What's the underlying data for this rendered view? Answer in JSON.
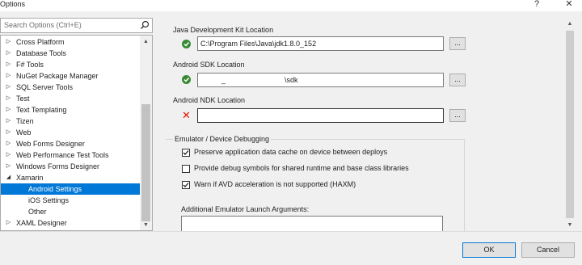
{
  "window": {
    "title": "Options",
    "help_glyph": "?",
    "close_glyph": "✕"
  },
  "search": {
    "placeholder": "Search Options (Ctrl+E)"
  },
  "tree": {
    "items": [
      {
        "label": "Cross Platform",
        "expander": "▷",
        "selected": false
      },
      {
        "label": "Database Tools",
        "expander": "▷",
        "selected": false
      },
      {
        "label": "F# Tools",
        "expander": "▷",
        "selected": false
      },
      {
        "label": "NuGet Package Manager",
        "expander": "▷",
        "selected": false
      },
      {
        "label": "SQL Server Tools",
        "expander": "▷",
        "selected": false
      },
      {
        "label": "Test",
        "expander": "▷",
        "selected": false
      },
      {
        "label": "Text Templating",
        "expander": "▷",
        "selected": false
      },
      {
        "label": "Tizen",
        "expander": "▷",
        "selected": false
      },
      {
        "label": "Web",
        "expander": "▷",
        "selected": false
      },
      {
        "label": "Web Forms Designer",
        "expander": "▷",
        "selected": false
      },
      {
        "label": "Web Performance Test Tools",
        "expander": "▷",
        "selected": false
      },
      {
        "label": "Windows Forms Designer",
        "expander": "▷",
        "selected": false
      },
      {
        "label": "Xamarin",
        "expander": "◢",
        "selected": false
      },
      {
        "label": "Android Settings",
        "expander": "",
        "selected": true
      },
      {
        "label": "iOS Settings",
        "expander": "",
        "selected": false
      },
      {
        "label": "Other",
        "expander": "",
        "selected": false
      },
      {
        "label": "XAML Designer",
        "expander": "▷",
        "selected": false
      }
    ]
  },
  "settings": {
    "jdk": {
      "label": "Java Development Kit Location",
      "value": "C:\\Program Files\\Java\\jdk1.8.0_152",
      "status": "ok",
      "browse": "..."
    },
    "sdk": {
      "label": "Android SDK Location",
      "value_part1": "_",
      "value_part2": "\\sdk",
      "status": "ok",
      "browse": "..."
    },
    "ndk": {
      "label": "Android NDK Location",
      "value": "",
      "status": "error",
      "error_glyph": "✕",
      "browse": "..."
    }
  },
  "emulator": {
    "group_label": "Emulator / Device Debugging",
    "options": [
      {
        "label": "Preserve application data cache on device between deploys",
        "checked": true
      },
      {
        "label": "Provide debug symbols for shared runtime and base class libraries",
        "checked": false
      },
      {
        "label": "Warn if AVD acceleration is not supported (HAXM)",
        "checked": true
      }
    ],
    "args_label": "Additional Emulator Launch Arguments:",
    "args_value": ""
  },
  "buttons": {
    "ok": "OK",
    "cancel": "Cancel"
  },
  "colors": {
    "selection": "#0078d7",
    "ok_status": "#388a34",
    "error_status": "#e51400"
  }
}
